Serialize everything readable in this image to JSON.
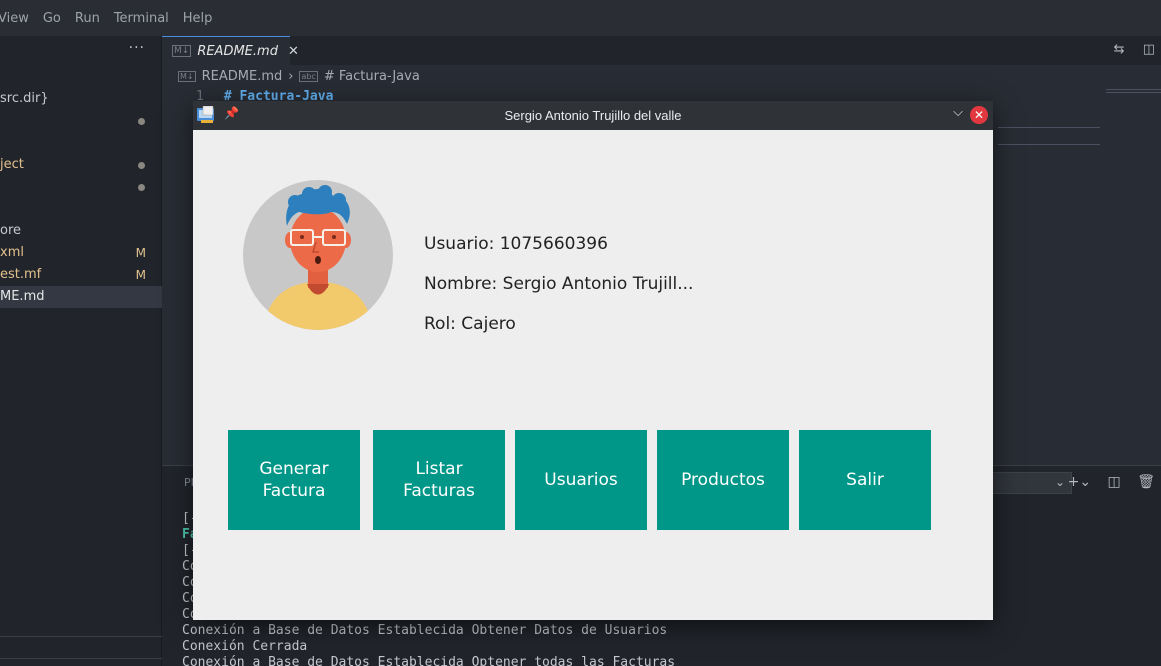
{
  "menubar": {
    "items": [
      "View",
      "Go",
      "Run",
      "Terminal",
      "Help"
    ]
  },
  "sidebar": {
    "more_label": "···",
    "items": [
      {
        "label": "src.dir}",
        "color": "#c5c8cd",
        "status": ""
      },
      {
        "label": "",
        "color": "#c5c8cd",
        "status": "dot"
      },
      {
        "label": "ject",
        "color": "#e2c08d",
        "status": "dot"
      },
      {
        "label": "",
        "color": "#c5c8cd",
        "status": "dot"
      },
      {
        "label": "ore",
        "color": "#c5c8cd",
        "status": ""
      },
      {
        "label": "xml",
        "color": "#e2c08d",
        "status": "M"
      },
      {
        "label": "est.mf",
        "color": "#e2c08d",
        "status": "M"
      },
      {
        "label": "ME.md",
        "color": "#e6e6e6",
        "status": ""
      }
    ]
  },
  "editor": {
    "tab_label": "README.md",
    "tab_close": "✕",
    "breadcrumb_file": "README.md",
    "breadcrumb_sep": "›",
    "breadcrumb_symbol": "# Factura-Java",
    "line_number": "1",
    "line_text": "# Factura-Java"
  },
  "panel": {
    "tab_label": "PI",
    "terminal_lines": [
      {
        "text": "[-",
        "style": "normal"
      },
      {
        "text": "Fa",
        "style": "green"
      },
      {
        "text": "[-",
        "style": "normal"
      },
      {
        "text": "Con",
        "style": "normal"
      },
      {
        "text": "Co",
        "style": "normal"
      },
      {
        "text": "Co",
        "style": "normal"
      },
      {
        "text": "Co",
        "style": "normal"
      },
      {
        "text": "Conexión a Base de Datos Establecida Obtener Datos de Usuarios",
        "style": "normal"
      },
      {
        "text": "Conexión Cerrada",
        "style": "normal"
      },
      {
        "text": "Conexión a Base de Datos Establecida Optener todas las Facturas",
        "style": "normal"
      }
    ]
  },
  "dialog": {
    "title": "Sergio Antonio Trujillo del valle",
    "usuario": "Usuario: 1075660396",
    "nombre": "Nombre: Sergio Antonio Trujill...",
    "rol": "Rol: Cajero",
    "buttons": {
      "generar": "Generar\nFactura",
      "listar": "Listar\nFacturas",
      "usuarios": "Usuarios",
      "productos": "Productos",
      "salir": "Salir"
    },
    "button_color": "#009688"
  },
  "icons": {
    "pin": "pin-icon",
    "minimize": "chevron-down-icon",
    "close": "close-icon",
    "app": "app-icon"
  }
}
